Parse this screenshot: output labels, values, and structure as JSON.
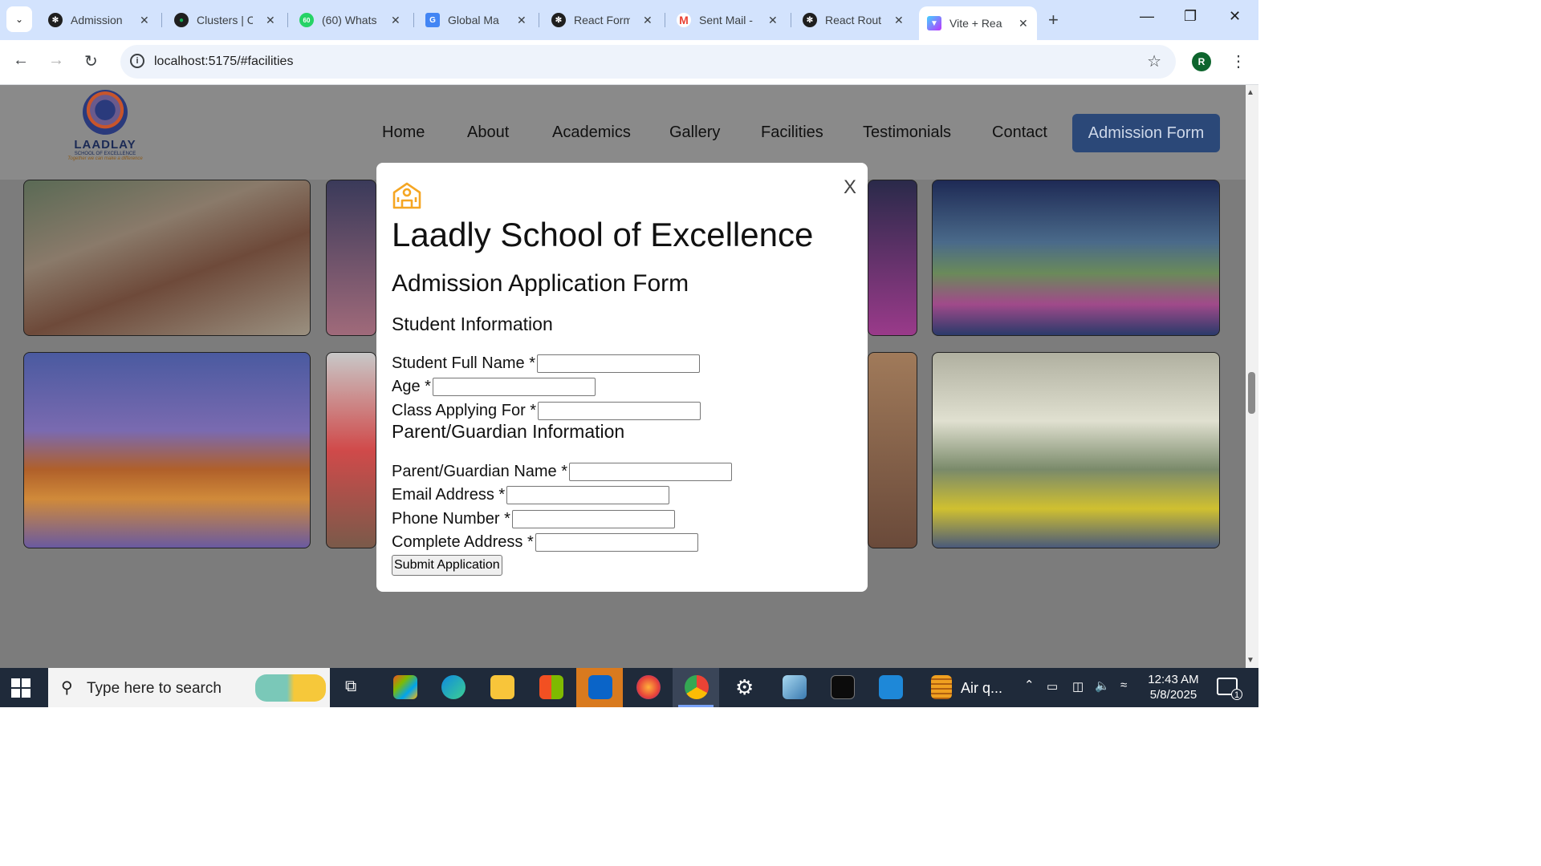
{
  "browser": {
    "tabs": [
      {
        "title": "Admission",
        "icon": "openai-icon",
        "color": "#1f1f1f"
      },
      {
        "title": "Clusters | C",
        "icon": "mongodb-leaf-icon",
        "color": "#1f1f1f"
      },
      {
        "title": "(60) Whats",
        "icon": "whatsapp-icon",
        "color": "#25d366",
        "badge": "60"
      },
      {
        "title": "Global Ma",
        "icon": "google-docs-icon",
        "color": "#4285f4"
      },
      {
        "title": "React Form",
        "icon": "openai-icon",
        "color": "#1f1f1f"
      },
      {
        "title": "Sent Mail -",
        "icon": "gmail-icon",
        "color": "#ea4335"
      },
      {
        "title": "React Rout",
        "icon": "openai-icon",
        "color": "#1f1f1f"
      },
      {
        "title": "Vite + Rea",
        "icon": "vite-icon",
        "color": "#a855f7",
        "active": true
      }
    ],
    "url": "localhost:5175/#facilities",
    "profile_initial": "R"
  },
  "site": {
    "logo": {
      "name": "LAADLAY",
      "sub": "SCHOOL OF EXCELLENCE",
      "tagline": "Together we can make a difference"
    },
    "nav": [
      "Home",
      "About",
      "Academics",
      "Gallery",
      "Facilities",
      "Testimonials",
      "Contact"
    ],
    "cta": "Admission Form"
  },
  "modal": {
    "close_label": "X",
    "school_name": "Laadly School of Excellence",
    "form_title": "Admission Application Form",
    "student_section": "Student Information",
    "student_fields": [
      {
        "label": "Student Full Name *",
        "value": ""
      },
      {
        "label": "Age *",
        "value": ""
      },
      {
        "label": "Class Applying For *",
        "value": ""
      }
    ],
    "parent_section": "Parent/Guardian Information",
    "parent_fields": [
      {
        "label": "Parent/Guardian Name *",
        "value": ""
      },
      {
        "label": "Email Address *",
        "value": ""
      },
      {
        "label": "Phone Number *",
        "value": ""
      },
      {
        "label": "Complete Address *",
        "value": ""
      }
    ],
    "submit_label": "Submit Application",
    "accent_color": "#f5a623"
  },
  "taskbar": {
    "search_placeholder": "Type here to search",
    "tray_app": "Air q...",
    "time": "12:43 AM",
    "date": "5/8/2025",
    "notification_count": "1"
  }
}
